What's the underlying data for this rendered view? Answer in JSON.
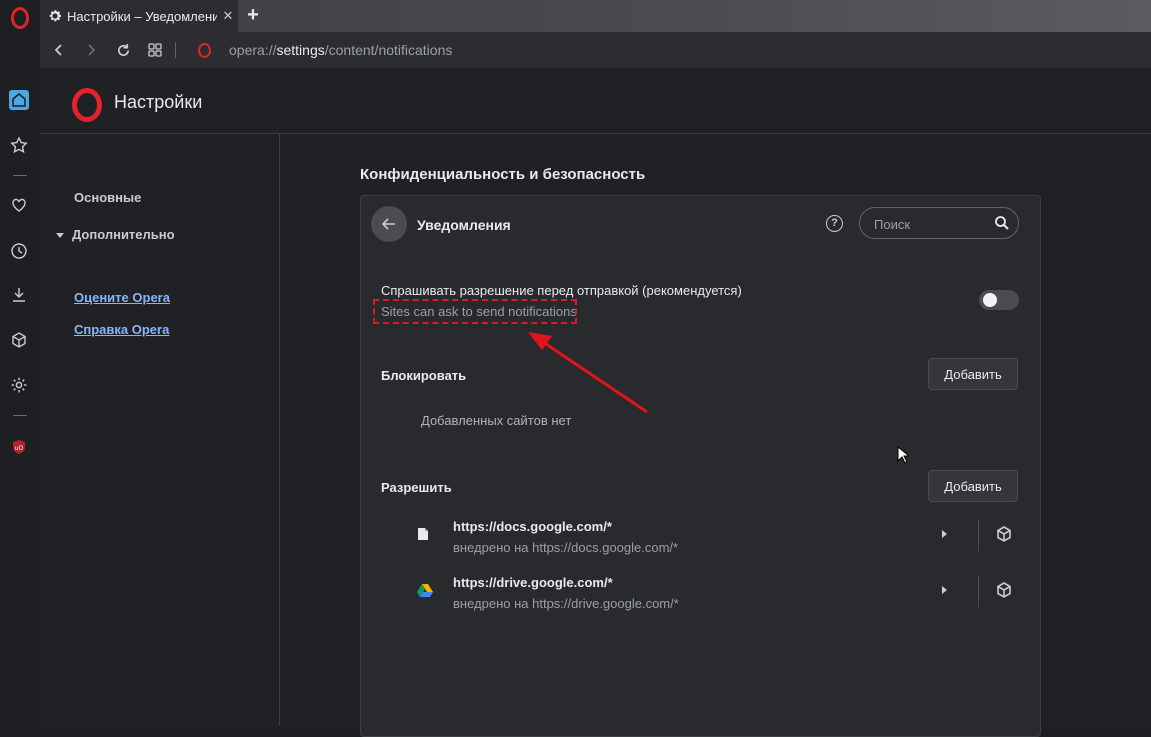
{
  "window": {
    "tab_title": "Настройки – Уведомления",
    "tab_close": "✕",
    "new_tab": "+"
  },
  "address_bar": {
    "url_scheme": "opera://",
    "url_host": "settings",
    "url_path": "/content/notifications"
  },
  "sidebar": {
    "icons": [
      "home-icon",
      "star-icon",
      "heart-icon",
      "history-icon",
      "download-icon",
      "cube-icon",
      "settings-icon",
      "ublock-icon"
    ]
  },
  "header": {
    "title": "Настройки"
  },
  "leftnav": {
    "basic": "Основные",
    "advanced": "Дополнительно",
    "rate": "Оцените Opera",
    "help": "Справка Opera"
  },
  "main": {
    "section_title": "Конфиденциальность и безопасность",
    "card": {
      "title": "Уведомления",
      "help_glyph": "?",
      "search_placeholder": "Поиск",
      "ask": {
        "label": "Спрашивать разрешение перед отправкой (рекомендуется)",
        "sublabel": "Sites can ask to send notifications",
        "enabled": false
      },
      "block": {
        "label": "Блокировать",
        "add_button": "Добавить",
        "empty_text": "Добавленных сайтов нет"
      },
      "allow": {
        "label": "Разрешить",
        "add_button": "Добавить",
        "sites": [
          {
            "url": "https://docs.google.com/*",
            "embedded": "внедрено на https://docs.google.com/*",
            "icon": "document-icon"
          },
          {
            "url": "https://drive.google.com/*",
            "embedded": "внедрено на https://drive.google.com/*",
            "icon": "google-drive-icon"
          }
        ]
      }
    }
  },
  "colors": {
    "accent_red": "#e3222b",
    "annotation_red": "#d21f26",
    "link_blue": "#8ab4f8",
    "home_blue": "#4aa8e4"
  }
}
